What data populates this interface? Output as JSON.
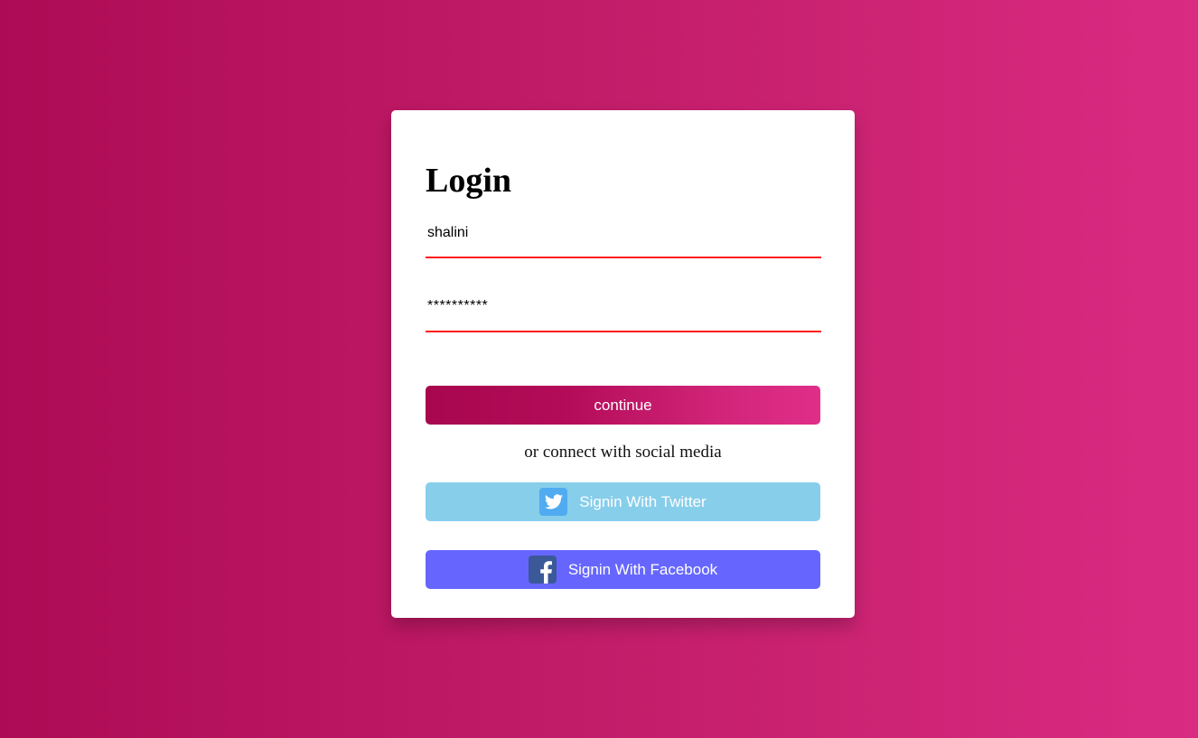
{
  "login": {
    "title": "Login",
    "username": "shalini",
    "password": "**********",
    "continue_label": "continue",
    "social_text": "or connect with social media",
    "twitter_label": "Signin With Twitter",
    "facebook_label": "Signin With Facebook"
  },
  "icons": {
    "twitter": "twitter-bird-icon",
    "facebook": "facebook-f-icon"
  },
  "colors": {
    "accent_line": "#ff1a1a",
    "twitter_button": "#87ceeb",
    "facebook_button": "#6666ff"
  }
}
